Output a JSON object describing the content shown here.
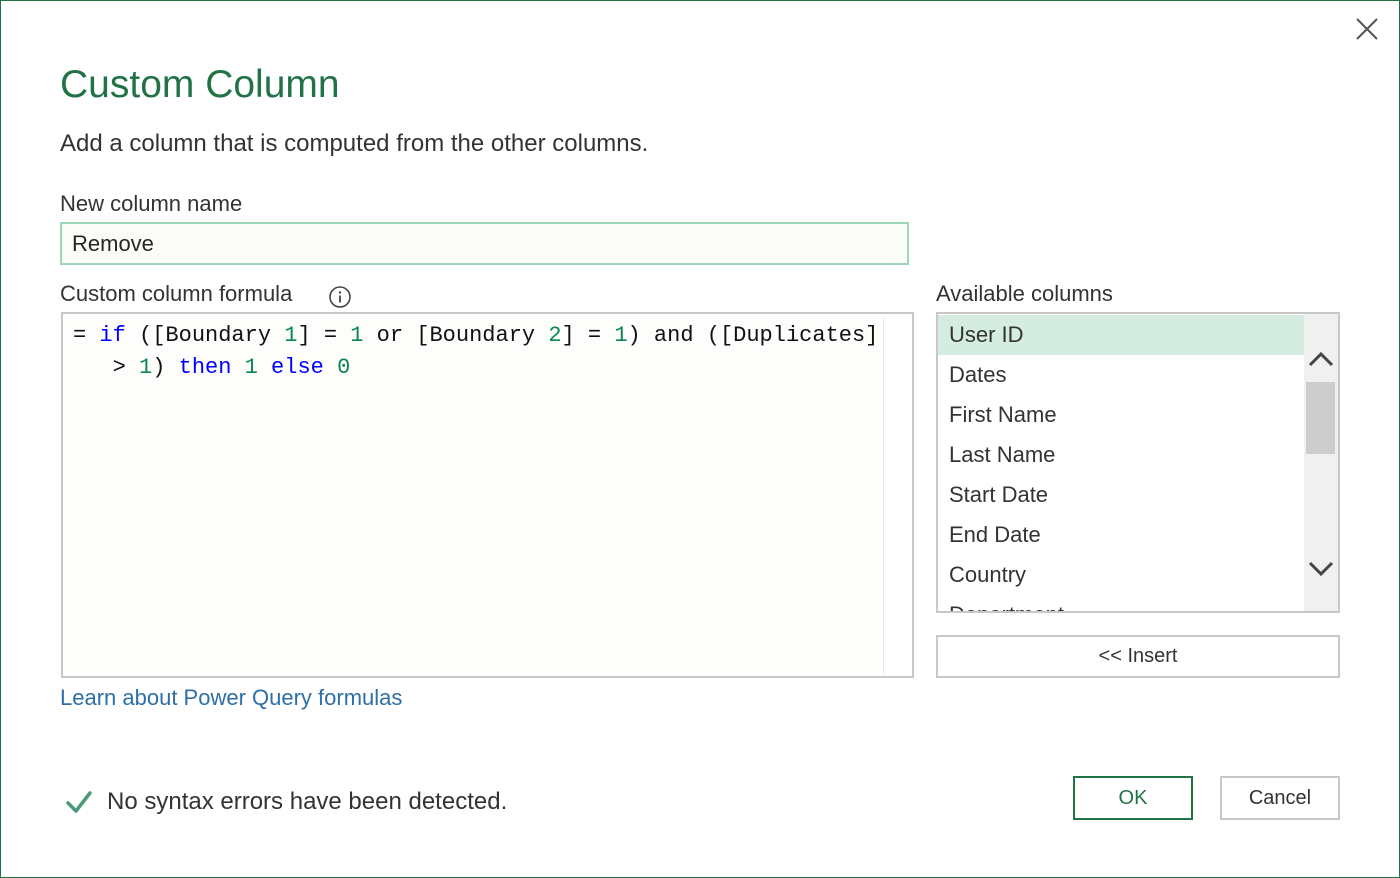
{
  "dialog": {
    "title": "Custom Column",
    "subtitle": "Add a column that is computed from the other columns."
  },
  "name_field": {
    "label": "New column name",
    "value": "Remove"
  },
  "formula": {
    "label": "Custom column formula",
    "tokens": {
      "eq": "= ",
      "if": "if",
      "p1": " ([Boundary ",
      "n1": "1",
      "p2": "] = ",
      "n2": "1",
      "p3": " or [Boundary ",
      "n3": "2",
      "p4": "] = ",
      "n4": "1",
      "p5": ") and ([Duplicates]",
      "p6": "   > ",
      "n5": "1",
      "p7": ") ",
      "then": "then",
      "sp1": " ",
      "n6": "1",
      "sp2": " ",
      "else": "else",
      "sp3": " ",
      "n7": "0"
    },
    "learn_link": "Learn about Power Query formulas"
  },
  "available": {
    "label": "Available columns",
    "items": [
      "User ID",
      "Dates",
      "First Name",
      "Last Name",
      "Start Date",
      "End Date",
      "Country",
      "Department"
    ],
    "selected": "User ID",
    "insert_label": "<< Insert"
  },
  "status": {
    "text": "No syntax errors have been detected."
  },
  "buttons": {
    "ok": "OK",
    "cancel": "Cancel"
  },
  "colors": {
    "accent": "#217346",
    "keyword": "#0000ff",
    "number": "#098658",
    "selection": "#d5ede0",
    "link": "#2e6fa6"
  },
  "icons": {
    "close": "close-icon",
    "info": "info-icon",
    "scroll_up": "chevron-up-icon",
    "scroll_down": "chevron-down-icon",
    "status": "checkmark-icon"
  }
}
